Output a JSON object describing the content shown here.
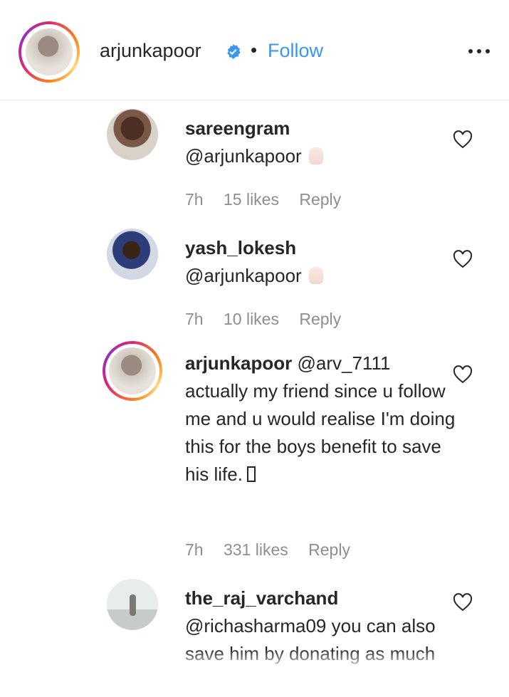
{
  "header": {
    "username": "arjunkapoor",
    "separator": "•",
    "follow_label": "Follow",
    "verified": true,
    "icons": {
      "verified": "verified-badge-icon",
      "more": "more-horizontal-icon"
    }
  },
  "comments": [
    {
      "username": "sareengram",
      "text": "@arjunkapoor",
      "emoji": "hands-icon",
      "time": "7h",
      "likes": "15 likes",
      "reply_label": "Reply"
    },
    {
      "username": "yash_lokesh",
      "text": "@arjunkapoor",
      "emoji": "hands-icon",
      "time": "7h",
      "likes": "10 likes",
      "reply_label": "Reply"
    },
    {
      "username": "arjunkapoor",
      "mention": "@arv_7111",
      "text": "actually my friend since u follow me and u would realise I'm doing this for the boys benefit to save his life.",
      "time": "7h",
      "likes": "331 likes",
      "reply_label": "Reply"
    },
    {
      "username": "the_raj_varchand",
      "mention": "@richasharma09",
      "text": "you can also save him by donating as much as you"
    }
  ],
  "colors": {
    "accent": "#3897f0",
    "text": "#262626",
    "meta": "#8e8e8e"
  }
}
